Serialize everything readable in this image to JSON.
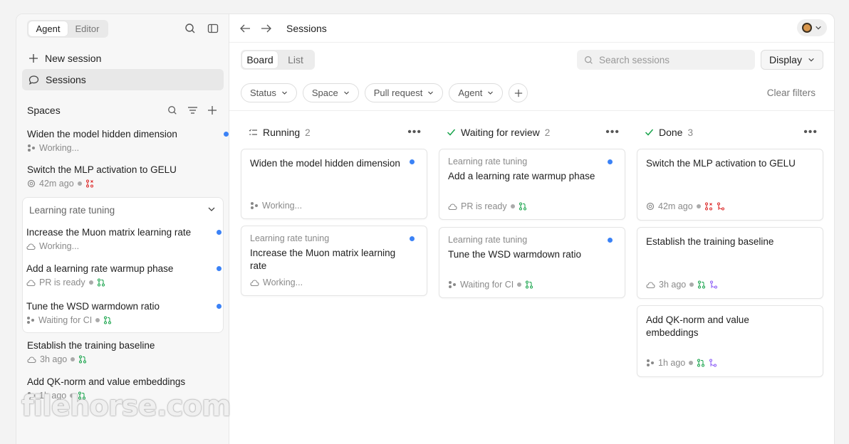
{
  "sidebar": {
    "modes": [
      "Agent",
      "Editor"
    ],
    "new_session": "New session",
    "sessions": "Sessions",
    "spaces_title": "Spaces",
    "items": [
      {
        "title": "Widen the model hidden dimension",
        "meta": "Working..."
      },
      {
        "title": "Switch the MLP activation to GELU",
        "meta": "42m ago"
      },
      {
        "title": "Establish the training baseline",
        "meta": "3h ago"
      },
      {
        "title": "Add QK-norm and value embeddings",
        "meta": "1h ago"
      }
    ],
    "group": {
      "name": "Learning rate tuning",
      "items": [
        {
          "title": "Increase the Muon matrix learning rate",
          "meta": "Working..."
        },
        {
          "title": "Add a learning rate warmup phase",
          "meta": "PR is ready"
        },
        {
          "title": "Tune the WSD warmdown ratio",
          "meta": "Waiting for CI"
        }
      ]
    }
  },
  "main": {
    "title": "Sessions",
    "views": [
      "Board",
      "List"
    ],
    "search_placeholder": "Search sessions",
    "display": "Display",
    "filters": [
      "Status",
      "Space",
      "Pull request",
      "Agent"
    ],
    "clear_filters": "Clear filters",
    "columns": [
      {
        "name": "Running",
        "count": "2",
        "cards": [
          {
            "title": "Widen the model hidden dimension",
            "meta": "Working..."
          },
          {
            "space": "Learning rate tuning",
            "title": "Increase the Muon matrix learning rate",
            "meta": "Working..."
          }
        ]
      },
      {
        "name": "Waiting for review",
        "count": "2",
        "cards": [
          {
            "space": "Learning rate tuning",
            "title": "Add a learning rate warmup phase",
            "meta": "PR is ready"
          },
          {
            "space": "Learning rate tuning",
            "title": "Tune the WSD warmdown ratio",
            "meta": "Waiting for CI"
          }
        ]
      },
      {
        "name": "Done",
        "count": "3",
        "cards": [
          {
            "title": "Switch the MLP activation to GELU",
            "meta": "42m ago"
          },
          {
            "title": "Establish the training baseline",
            "meta": "3h ago"
          },
          {
            "title": "Add QK-norm and value embeddings",
            "meta": "1h ago"
          }
        ]
      }
    ]
  },
  "watermark": "filehorse.com",
  "colors": {
    "blue_dot": "#3b82f6",
    "pr_green": "#16a34a",
    "pr_red": "#dc2626",
    "merged_purple": "#8b5cf6"
  }
}
